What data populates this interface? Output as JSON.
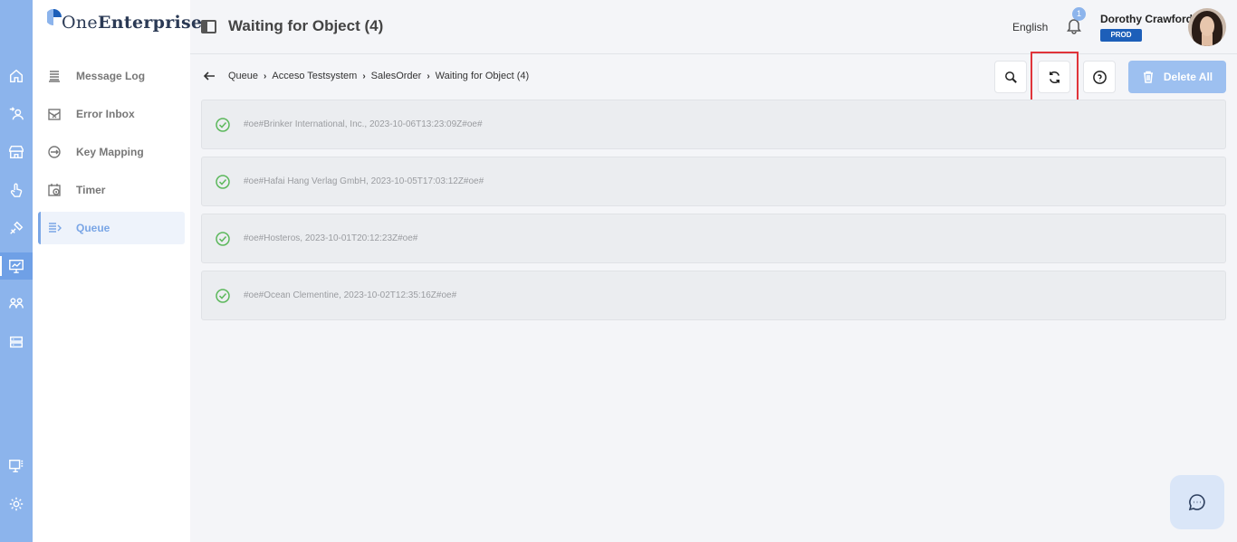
{
  "brand": {
    "logo_prefix": "One",
    "logo_suffix": "Enterprise"
  },
  "rail": {
    "items": [
      {
        "icon": "home-icon",
        "active": false
      },
      {
        "icon": "users-exchange-icon",
        "active": false
      },
      {
        "icon": "store-icon",
        "active": false
      },
      {
        "icon": "touch-hand-icon",
        "active": false
      },
      {
        "icon": "tools-icon",
        "active": false
      },
      {
        "icon": "monitor-chart-icon",
        "active": true
      },
      {
        "icon": "people-icon",
        "active": false
      },
      {
        "icon": "server-icon",
        "active": false
      }
    ],
    "bottom": [
      {
        "icon": "display-grid-icon"
      },
      {
        "icon": "settings-gear-icon"
      }
    ]
  },
  "sidebar": {
    "items": [
      {
        "label": "Message Log",
        "icon": "message-log-icon",
        "active": false
      },
      {
        "label": "Error Inbox",
        "icon": "error-inbox-icon",
        "active": false
      },
      {
        "label": "Key Mapping",
        "icon": "key-mapping-icon",
        "active": false
      },
      {
        "label": "Timer",
        "icon": "timer-icon",
        "active": false
      },
      {
        "label": "Queue",
        "icon": "queue-icon",
        "active": true
      }
    ]
  },
  "header": {
    "title": "Waiting for Object (4)",
    "language": "English",
    "notification_count": "1",
    "user_name": "Dorothy Crawford",
    "environment": "PROD"
  },
  "breadcrumb": [
    "Queue",
    "Acceso Testsystem",
    "SalesOrder",
    "Waiting for Object (4)"
  ],
  "toolbar": {
    "delete_all_label": "Delete All"
  },
  "queue_items": [
    {
      "text": "#oe#Brinker International, Inc., 2023-10-06T13:23:09Z#oe#",
      "status": "ok"
    },
    {
      "text": "#oe#Hafai Hang Verlag GmbH, 2023-10-05T17:03:12Z#oe#",
      "status": "ok"
    },
    {
      "text": "#oe#Hosteros, 2023-10-01T20:12:23Z#oe#",
      "status": "ok"
    },
    {
      "text": "#oe#Ocean Clementine, 2023-10-02T12:35:16Z#oe#",
      "status": "ok"
    }
  ],
  "colors": {
    "rail": "#8cb4ec",
    "accent": "#7aa6e6",
    "prod_badge": "#1d5fb9",
    "success": "#5cb85c",
    "highlight": "#e0343a"
  }
}
